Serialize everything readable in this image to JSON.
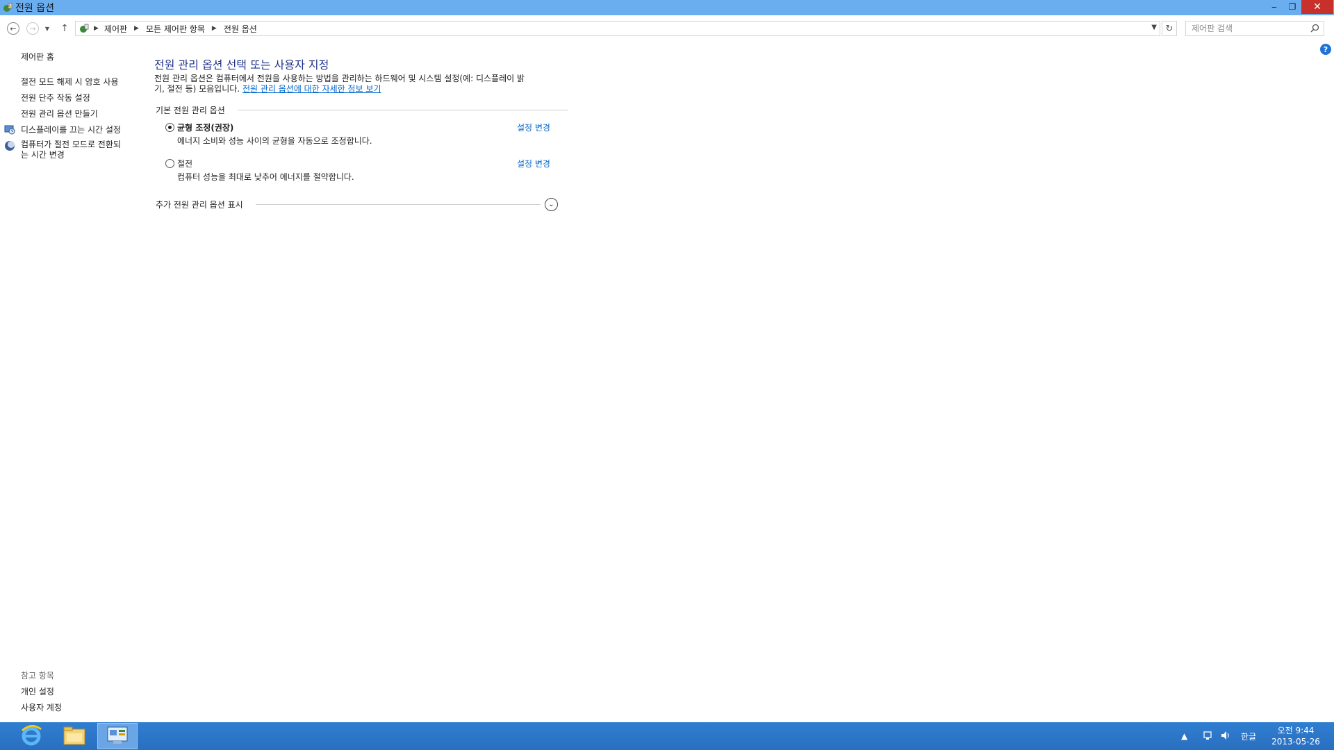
{
  "window": {
    "title": "전원 옵션",
    "app_icon": "power-options-icon",
    "controls": {
      "minimize": "‒",
      "maximize": "❐",
      "close": "✕"
    }
  },
  "navbar": {
    "breadcrumbs": [
      "제어판",
      "모든 제어판 항목",
      "전원 옵션"
    ],
    "search_placeholder": "제어판 검색"
  },
  "sidebar": {
    "home": "제어판 홈",
    "items": [
      {
        "label": "절전 모드 해제 시 암호 사용",
        "icon": null
      },
      {
        "label": "전원 단추 작동 설정",
        "icon": null
      },
      {
        "label": "전원 관리 옵션 만들기",
        "icon": null
      },
      {
        "label": "디스플레이를 끄는 시간 설정",
        "icon": "display-icon"
      },
      {
        "label_line1": "컴퓨터가 절전 모드로 전환되",
        "label_line2": "는 시간 변경",
        "icon": "moon-sleep-icon"
      }
    ],
    "see_also": {
      "title": "참고 항목",
      "links": [
        "개인 설정",
        "사용자 계정"
      ]
    }
  },
  "main": {
    "heading": "전원 관리 옵션 선택 또는 사용자 지정",
    "description_line1": "전원 관리 옵션은 컴퓨터에서 전원을 사용하는 방법을 관리하는 하드웨어 및 시스템 설정(예: 디스플레이 밝",
    "description_line2": "기, 절전 등) 모음입니다.",
    "description_link": "전원 관리 옵션에 대한 자세한 정보 보기",
    "group_label": "기본 전원 관리 옵션",
    "plans": [
      {
        "name": "균형 조정(권장)",
        "description": "에너지 소비와 성능 사이의 균형을 자동으로 조정합니다.",
        "link": "설정 변경",
        "selected": true
      },
      {
        "name": "절전",
        "description": "컴퓨터 성능을 최대로 낮추어 에너지를 절약합니다.",
        "link": "설정 변경",
        "selected": false
      }
    ],
    "extra_label": "추가 전원 관리 옵션 표시"
  },
  "taskbar": {
    "apps": [
      {
        "name": "internet-explorer-icon",
        "active": false
      },
      {
        "name": "file-explorer-icon",
        "active": false
      },
      {
        "name": "control-panel-icon",
        "active": true
      }
    ],
    "tray": {
      "ime": "한글",
      "time": "오전 9:44",
      "date": "2013-05-26"
    }
  },
  "colors": {
    "titlebar": "#6aaef0",
    "heading": "#1e3287",
    "link": "#0066cc",
    "taskbar": "#2f7ed1",
    "close": "#c7302b"
  }
}
